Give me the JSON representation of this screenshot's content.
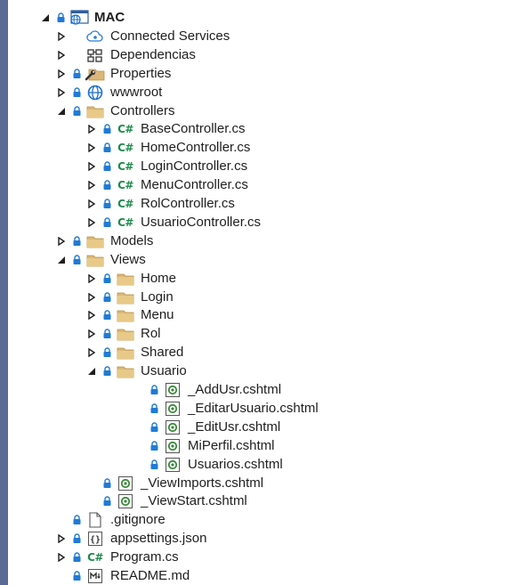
{
  "explorer": {
    "items": [
      {
        "name": "project-mac",
        "label": "MAC",
        "icon": "project-icon",
        "expander": "expanded",
        "lock": true,
        "depth": 0,
        "bold": true
      },
      {
        "name": "connected-services",
        "label": "Connected Services",
        "icon": "connected-services-icon",
        "expander": "collapsed",
        "lock": false,
        "depth": 1
      },
      {
        "name": "dependencias",
        "label": "Dependencias",
        "icon": "dependencies-icon",
        "expander": "collapsed",
        "lock": false,
        "depth": 1
      },
      {
        "name": "properties",
        "label": "Properties",
        "icon": "properties-folder-icon",
        "expander": "collapsed",
        "lock": true,
        "depth": 1
      },
      {
        "name": "wwwroot",
        "label": "wwwroot",
        "icon": "globe-icon",
        "expander": "collapsed",
        "lock": true,
        "depth": 1
      },
      {
        "name": "controllers",
        "label": "Controllers",
        "icon": "folder-icon",
        "expander": "expanded",
        "lock": true,
        "depth": 1
      },
      {
        "name": "base-controller",
        "label": "BaseController.cs",
        "icon": "csharp-file-icon",
        "expander": "collapsed",
        "lock": true,
        "depth": 2
      },
      {
        "name": "home-controller",
        "label": "HomeController.cs",
        "icon": "csharp-file-icon",
        "expander": "collapsed",
        "lock": true,
        "depth": 2
      },
      {
        "name": "login-controller",
        "label": "LoginController.cs",
        "icon": "csharp-file-icon",
        "expander": "collapsed",
        "lock": true,
        "depth": 2
      },
      {
        "name": "menu-controller",
        "label": "MenuController.cs",
        "icon": "csharp-file-icon",
        "expander": "collapsed",
        "lock": true,
        "depth": 2
      },
      {
        "name": "rol-controller",
        "label": "RolController.cs",
        "icon": "csharp-file-icon",
        "expander": "collapsed",
        "lock": true,
        "depth": 2
      },
      {
        "name": "usuario-controller",
        "label": "UsuarioController.cs",
        "icon": "csharp-file-icon",
        "expander": "collapsed",
        "lock": true,
        "depth": 2
      },
      {
        "name": "models",
        "label": "Models",
        "icon": "folder-icon",
        "expander": "collapsed",
        "lock": true,
        "depth": 1
      },
      {
        "name": "views",
        "label": "Views",
        "icon": "folder-icon",
        "expander": "expanded",
        "lock": true,
        "depth": 1
      },
      {
        "name": "views-home",
        "label": "Home",
        "icon": "folder-icon",
        "expander": "collapsed",
        "lock": true,
        "depth": 2
      },
      {
        "name": "views-login",
        "label": "Login",
        "icon": "folder-icon",
        "expander": "collapsed",
        "lock": true,
        "depth": 2
      },
      {
        "name": "views-menu",
        "label": "Menu",
        "icon": "folder-icon",
        "expander": "collapsed",
        "lock": true,
        "depth": 2
      },
      {
        "name": "views-rol",
        "label": "Rol",
        "icon": "folder-icon",
        "expander": "collapsed",
        "lock": true,
        "depth": 2
      },
      {
        "name": "views-shared",
        "label": "Shared",
        "icon": "folder-icon",
        "expander": "collapsed",
        "lock": true,
        "depth": 2
      },
      {
        "name": "views-usuario",
        "label": "Usuario",
        "icon": "folder-icon",
        "expander": "expanded",
        "lock": true,
        "depth": 2
      },
      {
        "name": "add-usr-view",
        "label": "_AddUsr.cshtml",
        "icon": "razor-file-icon",
        "expander": "none",
        "lock": true,
        "depth": 3
      },
      {
        "name": "editar-usuario-view",
        "label": "_EditarUsuario.cshtml",
        "icon": "razor-file-icon",
        "expander": "none",
        "lock": true,
        "depth": 3
      },
      {
        "name": "edit-usr-view",
        "label": "_EditUsr.cshtml",
        "icon": "razor-file-icon",
        "expander": "none",
        "lock": true,
        "depth": 3
      },
      {
        "name": "mi-perfil-view",
        "label": "MiPerfil.cshtml",
        "icon": "razor-file-icon",
        "expander": "none",
        "lock": true,
        "depth": 3
      },
      {
        "name": "usuarios-view",
        "label": "Usuarios.cshtml",
        "icon": "razor-file-icon",
        "expander": "none",
        "lock": true,
        "depth": 3
      },
      {
        "name": "view-imports",
        "label": "_ViewImports.cshtml",
        "icon": "razor-file-icon",
        "expander": "none",
        "lock": true,
        "depth": 2
      },
      {
        "name": "view-start",
        "label": "_ViewStart.cshtml",
        "icon": "razor-file-icon",
        "expander": "none",
        "lock": true,
        "depth": 2
      },
      {
        "name": "gitignore",
        "label": ".gitignore",
        "icon": "blank-file-icon",
        "expander": "none",
        "lock": true,
        "depth": 1
      },
      {
        "name": "appsettings",
        "label": "appsettings.json",
        "icon": "json-file-icon",
        "expander": "collapsed",
        "lock": true,
        "depth": 1
      },
      {
        "name": "program",
        "label": "Program.cs",
        "icon": "csharp-file-icon",
        "expander": "collapsed",
        "lock": true,
        "depth": 1
      },
      {
        "name": "readme",
        "label": "README.md",
        "icon": "markdown-file-icon",
        "expander": "none",
        "lock": true,
        "depth": 1
      }
    ],
    "colors": {
      "folder": "#dcb67a",
      "lock": "#1f7bd6",
      "csharp": "#1f8a4c",
      "razor": "#3a8a3a",
      "globe": "#1f6fd0",
      "sidebar": "#5a6a95"
    }
  }
}
